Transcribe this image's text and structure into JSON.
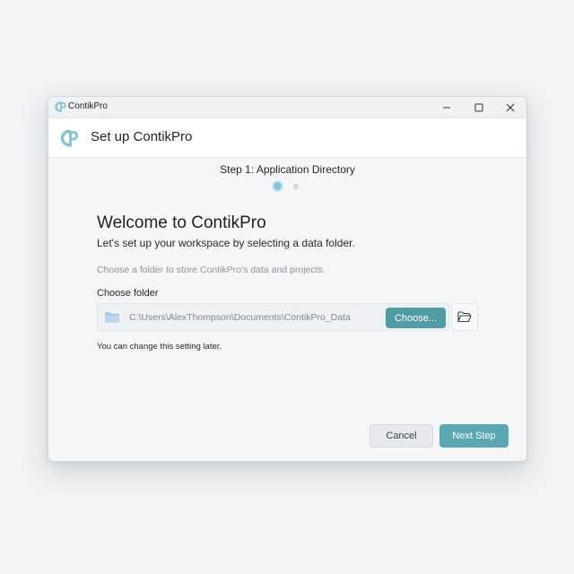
{
  "window": {
    "app_title": "ContikPro",
    "controls": {
      "minimize_icon": "minimize-icon",
      "maximize_icon": "maximize-icon",
      "close_icon": "close-icon"
    }
  },
  "header": {
    "logo_icon": "contikpro-logo",
    "title": "Set up ContikPro"
  },
  "stepper": {
    "title": "Step 1: Application Directory",
    "total_steps": 2,
    "current_step": 1
  },
  "content": {
    "welcome_heading": "Welcome to ContikPro",
    "subtitle": "Let's set up your workspace by selecting a data folder.",
    "hint": "Choose a folder to store ContikPro's data and projects.",
    "folder_label": "Choose folder",
    "folder_path": "C:\\Users\\AlexThompson\\Documents\\ContikPro_Data",
    "choose_button": "Choose...",
    "browse_icon": "folder-open-icon",
    "note": "You can change this setting later."
  },
  "footer": {
    "cancel_label": "Cancel",
    "next_label": "Next Step"
  },
  "colors": {
    "accent": "#5aa7b2",
    "accent_dark": "#4f9ba6",
    "logo": "#7fc4cf",
    "step_active": "#7fc6df"
  }
}
